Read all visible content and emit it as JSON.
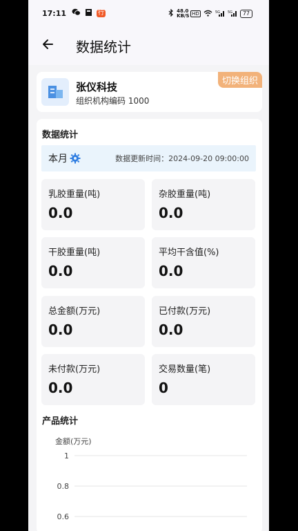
{
  "status_bar": {
    "time": "17:11",
    "net_speed": "48.0 KB/S",
    "battery": "77"
  },
  "header": {
    "title": "数据统计",
    "back_icon": "arrow-left-icon"
  },
  "org": {
    "name": "张仪科技",
    "code_label": "组织机构编码 1000",
    "switch_label": "切换组织",
    "logo_icon": "building-icon"
  },
  "stats": {
    "section_title": "数据统计",
    "period_label": "本月",
    "update_time": "数据更新时间：2024-09-20 09:00:00",
    "tiles": [
      {
        "label": "乳胶重量(吨)",
        "value": "0.0"
      },
      {
        "label": "杂胶重量(吨)",
        "value": "0.0"
      },
      {
        "label": "干胶重量(吨)",
        "value": "0.0"
      },
      {
        "label": "平均干含值(%)",
        "value": "0.0"
      },
      {
        "label": "总金额(万元)",
        "value": "0.0"
      },
      {
        "label": "已付款(万元)",
        "value": "0.0"
      },
      {
        "label": "未付款(万元)",
        "value": "0.0"
      },
      {
        "label": "交易数量(笔)",
        "value": "0"
      }
    ]
  },
  "product": {
    "section_title": "产品统计"
  },
  "chart_data": {
    "type": "bar",
    "ylabel": "金额(万元)",
    "yticks": [
      "1",
      "0.8",
      "0.6"
    ],
    "ylim": [
      0,
      1
    ],
    "series": []
  },
  "colors": {
    "accent": "#2f7de1",
    "switch_bg": "#f2b27a",
    "period_bg": "#eaf4fc"
  }
}
